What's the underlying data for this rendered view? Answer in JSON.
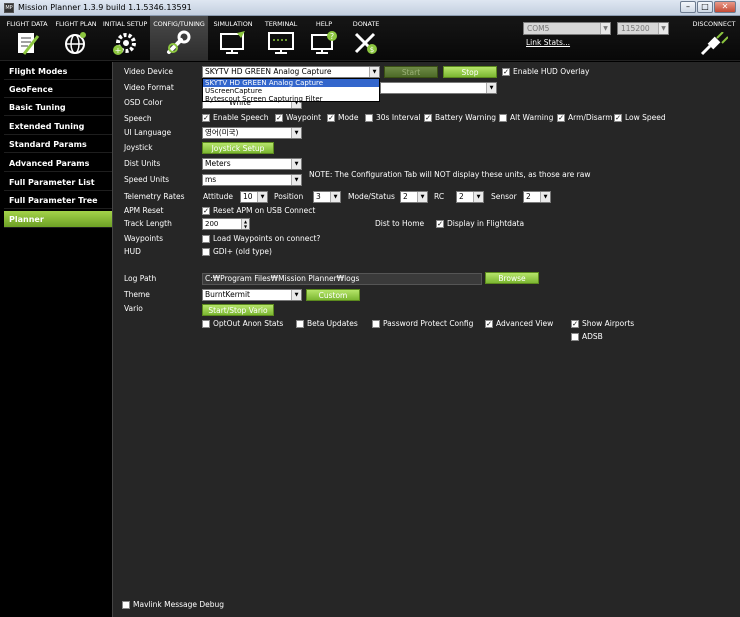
{
  "window": {
    "title": "Mission Planner 1.3.9 build 1.1.5346.13591",
    "app_icon_text": "MP",
    "minimize_glyph": "–",
    "maximize_glyph": "□",
    "close_glyph": "✕"
  },
  "menu": {
    "items": [
      {
        "label": "FLIGHT DATA",
        "icon": "flight-data-icon"
      },
      {
        "label": "FLIGHT PLAN",
        "icon": "globe-icon"
      },
      {
        "label": "INITIAL SETUP",
        "icon": "setup-gear-icon"
      },
      {
        "label": "CONFIG/TUNING",
        "icon": "wrench-icon"
      },
      {
        "label": "SIMULATION",
        "icon": "simulation-monitor-icon"
      },
      {
        "label": "TERMINAL",
        "icon": "terminal-monitor-icon"
      },
      {
        "label": "HELP",
        "icon": "help-monitor-icon"
      },
      {
        "label": "DONATE",
        "icon": "donate-plane-icon"
      }
    ],
    "active": "CONFIG/TUNING",
    "com_port": "COM5",
    "baud_rate": "115200",
    "link_stats": "Link Stats...",
    "disconnect": "DISCONNECT"
  },
  "sidebar": {
    "items": [
      {
        "label": "Flight Modes"
      },
      {
        "label": "GeoFence"
      },
      {
        "label": "Basic Tuning"
      },
      {
        "label": "Extended Tuning"
      },
      {
        "label": "Standard Params"
      },
      {
        "label": "Advanced Params"
      },
      {
        "label": "Full Parameter List"
      },
      {
        "label": "Full Parameter Tree"
      },
      {
        "label": "Planner"
      }
    ],
    "active": "Planner"
  },
  "planner": {
    "video_device": {
      "label": "Video Device",
      "value": "SKYTV HD GREEN Analog Capture",
      "options": [
        "SKYTV HD GREEN Analog Capture",
        "UScreenCapture",
        "Bytescout Screen Capturing Filter"
      ],
      "start_button": "Start",
      "stop_button": "Stop",
      "hud_overlay_label": "Enable HUD Overlay",
      "hud_overlay_checked": true
    },
    "video_format": {
      "label": "Video Format",
      "value": ""
    },
    "osd_color": {
      "label": "OSD Color",
      "value": "White"
    },
    "speech": {
      "label": "Speech",
      "options": [
        {
          "label": "Enable Speech",
          "checked": true
        },
        {
          "label": "Waypoint",
          "checked": true
        },
        {
          "label": "Mode",
          "checked": true
        },
        {
          "label": "30s Interval",
          "checked": false
        },
        {
          "label": "Battery Warning",
          "checked": true
        },
        {
          "label": "Alt Warning",
          "checked": false
        },
        {
          "label": "Arm/Disarm",
          "checked": true
        },
        {
          "label": "Low Speed",
          "checked": true
        }
      ]
    },
    "ui_language": {
      "label": "UI Language",
      "value": "영어(미국)"
    },
    "joystick": {
      "label": "Joystick",
      "button": "Joystick Setup"
    },
    "dist_units": {
      "label": "Dist Units",
      "value": "Meters",
      "note": "NOTE: The Configuration Tab will NOT display these units, as those are raw"
    },
    "speed_units": {
      "label": "Speed Units",
      "value": "ms"
    },
    "telemetry_rates": {
      "label": "Telemetry Rates",
      "fields": [
        {
          "label": "Attitude",
          "value": "10"
        },
        {
          "label": "Position",
          "value": "3"
        },
        {
          "label": "Mode/Status",
          "value": "2"
        },
        {
          "label": "RC",
          "value": "2"
        },
        {
          "label": "Sensor",
          "value": "2"
        }
      ]
    },
    "apm_reset": {
      "label": "APM Reset",
      "checkbox": "Reset APM on USB Connect",
      "checked": true
    },
    "track_length": {
      "label": "Track Length",
      "value": "200"
    },
    "dist_to_home": {
      "label": "Dist to Home",
      "checkbox": "Display in Flightdata",
      "checked": true
    },
    "waypoints": {
      "label": "Waypoints",
      "checkbox": "Load Waypoints on connect?",
      "checked": false
    },
    "hud": {
      "label": "HUD",
      "checkbox": "GDI+ (old type)",
      "checked": false
    },
    "log_path": {
      "label": "Log Path",
      "value": "C:₩Program Files₩Mission Planner₩logs",
      "button": "Browse"
    },
    "theme": {
      "label": "Theme",
      "value": "BurntKermit",
      "button": "Custom"
    },
    "vario": {
      "label": "Vario",
      "button": "Start/Stop Vario"
    },
    "misc": [
      {
        "label": "OptOut Anon Stats",
        "checked": false
      },
      {
        "label": "Beta Updates",
        "checked": false
      },
      {
        "label": "Password Protect Config",
        "checked": false
      },
      {
        "label": "Advanced View",
        "checked": true
      },
      {
        "label": "Show Airports",
        "checked": true
      },
      {
        "label": "ADSB",
        "checked": false
      }
    ],
    "mavlink_debug": {
      "label": "Mavlink Message Debug",
      "checked": false
    }
  },
  "colors": {
    "accent_green": "#8cc63f",
    "background": "#262626",
    "sidebar_bg": "#000000"
  }
}
